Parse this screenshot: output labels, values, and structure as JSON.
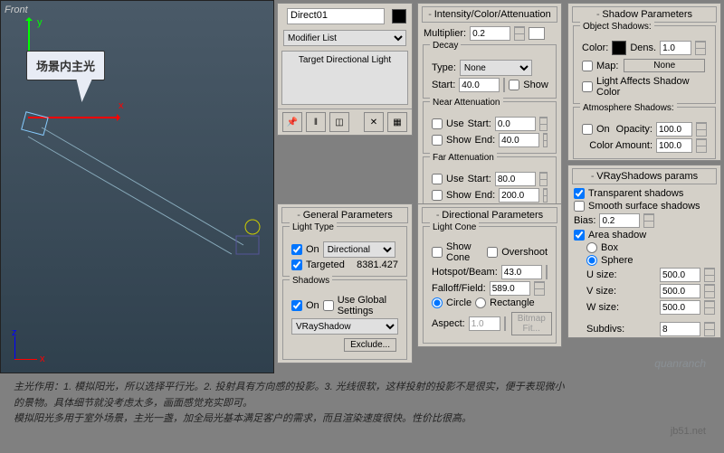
{
  "viewport": {
    "label": "Front",
    "callout": "场景内主光",
    "axis_x": "x",
    "axis_y": "y",
    "corner_x": "x",
    "corner_z": "z"
  },
  "modify": {
    "name": "Direct01",
    "modlist": "Modifier List",
    "stack": "Target Directional Light"
  },
  "general": {
    "title": "General Parameters",
    "lighttype_title": "Light Type",
    "on": "On",
    "type": "Directional",
    "targeted": "Targeted",
    "targ_val": "8381.427",
    "shadows_title": "Shadows",
    "on2": "On",
    "global": "Use Global Settings",
    "shadow": "VRayShadow",
    "exclude": "Exclude..."
  },
  "intensity": {
    "title": "Intensity/Color/Attenuation",
    "mult": "Multiplier:",
    "mult_v": "0.2",
    "decay_title": "Decay",
    "type": "Type:",
    "type_v": "None",
    "start": "Start:",
    "start_v": "40.0",
    "show": "Show",
    "near_title": "Near Attenuation",
    "use": "Use",
    "n_start": "Start:",
    "n_start_v": "0.0",
    "n_show": "Show",
    "n_end": "End:",
    "n_end_v": "40.0",
    "far_title": "Far Attenuation",
    "f_use": "Use",
    "f_start": "Start:",
    "f_start_v": "80.0",
    "f_show": "Show",
    "f_end": "End:",
    "f_end_v": "200.0"
  },
  "dir": {
    "title": "Directional Parameters",
    "cone_title": "Light Cone",
    "showcone": "Show Cone",
    "overshoot": "Overshoot",
    "hotspot": "Hotspot/Beam:",
    "hotspot_v": "43.0",
    "falloff": "Falloff/Field:",
    "falloff_v": "589.0",
    "circle": "Circle",
    "rect": "Rectangle",
    "aspect": "Aspect:",
    "aspect_v": "1.0",
    "bitmap": "Bitmap Fit..."
  },
  "shadow": {
    "title": "Shadow Parameters",
    "obj_title": "Object Shadows:",
    "color": "Color:",
    "dens": "Dens.",
    "dens_v": "1.0",
    "map": "Map:",
    "none": "None",
    "affects": "Light Affects Shadow Color",
    "atm_title": "Atmosphere Shadows:",
    "on": "On",
    "opac": "Opacity:",
    "opac_v": "100.0",
    "camt": "Color Amount:",
    "camt_v": "100.0"
  },
  "vray": {
    "title": "VRayShadows params",
    "trans": "Transparent shadows",
    "smooth": "Smooth surface shadows",
    "bias": "Bias:",
    "bias_v": "0.2",
    "area": "Area shadow",
    "box": "Box",
    "sphere": "Sphere",
    "u": "U size:",
    "u_v": "500.0",
    "v": "V size:",
    "v_v": "500.0",
    "w": "W size:",
    "w_v": "500.0",
    "subdiv": "Subdivs:",
    "subdiv_v": "8"
  },
  "footer": {
    "l1": "主光作用：1. 模拟阳光，所以选择平行光。2. 投射具有方向感的投影。3. 光线很软，这样投射的投影不是很实，便于表现微小",
    "l2": "的景物。具体细节就没考虑太多，画面感觉充实即可。",
    "l3": "模拟阳光多用于室外场景，主光一盏，加全局光基本满足客户的需求，而且渲染速度很快。性价比很高。"
  },
  "wm": "quanranch",
  "jb51": "jb51.net"
}
